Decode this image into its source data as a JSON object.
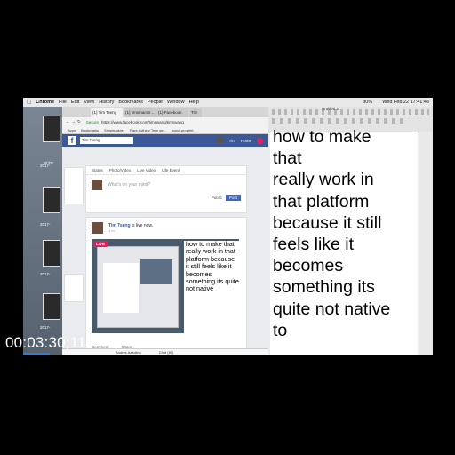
{
  "menubar": {
    "apple": "",
    "app": "Chrome",
    "items": [
      "File",
      "Edit",
      "View",
      "History",
      "Bookmarks",
      "People",
      "Window",
      "Help"
    ],
    "datetime": "Wed Feb 22  17:41:43",
    "battery": "80%"
  },
  "desktop": {
    "labels": [
      "2017-",
      "2017-",
      "2017-",
      "2017-"
    ],
    "side_label": "of the"
  },
  "browser": {
    "tabs": [
      "(1) Tim Tseng",
      "(1) timsmacthr...",
      "(1) Facebook",
      "Tim"
    ],
    "secure": "Secure",
    "url": "https://www.facebook.com/timswang/timswang",
    "bookmarks": [
      "Apps",
      "Bookmarks",
      "SimpleAdder",
      "Rare Aythetz Twin ge...",
      "manil-prophet"
    ]
  },
  "fb": {
    "logo": "f",
    "search_value": "Tim Tseng",
    "user": "Tim",
    "home": "Home",
    "composer_tabs": [
      "Status",
      "Photo/Video",
      "Live Video",
      "Life Event"
    ],
    "composer_placeholder": "What's on your mind?",
    "audience": "Public",
    "post_label": "Post",
    "live_author": "Tim Tseng",
    "live_verb": " is live now.",
    "live_meta": "1 m",
    "live_badge": "LIVE",
    "video_caption": "how to make that really work in that platform because it still feels like it becomes something its quite not native",
    "comment": "Comment",
    "share": "Share",
    "chat_user": "Andrés Azzolina",
    "chat": "Chat (81)"
  },
  "editor": {
    "title": "Untitled 2",
    "text": "how to make\nthat\nreally work in\nthat platform\nbecause it still\nfeels like it\nbecomes\nsomething its\nquite not native\nto"
  },
  "timecode": "00:03:30;11"
}
